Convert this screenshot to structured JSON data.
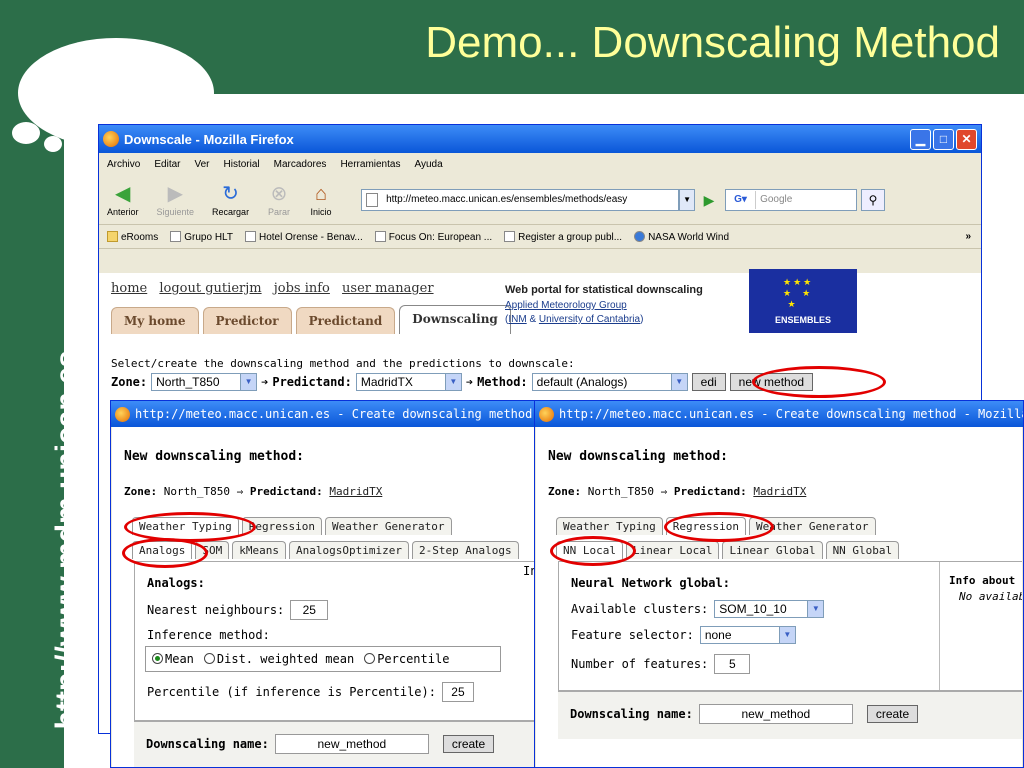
{
  "slide": {
    "title": "Demo... Downscaling Method",
    "vertical_url": "http://www.mdm.unican.es",
    "colors": {
      "green": "#2c6e49",
      "title": "#ffff99",
      "ring": "#e20000"
    }
  },
  "firefox": {
    "title": "Downscale - Mozilla Firefox",
    "menu": [
      "Archivo",
      "Editar",
      "Ver",
      "Historial",
      "Marcadores",
      "Herramientas",
      "Ayuda"
    ],
    "toolbar": {
      "back": "Anterior",
      "forward": "Siguiente",
      "reload": "Recargar",
      "stop": "Parar",
      "home": "Inicio",
      "url": "http://meteo.macc.unican.es/ensembles/methods/easy",
      "search_placeholder": "Google"
    },
    "bookmarks": [
      "eRooms",
      "Grupo HLT",
      "Hotel Orense - Benav...",
      "Focus On: European ...",
      "Register a group publ...",
      "NASA World Wind"
    ],
    "bookmarks_more": "»"
  },
  "page": {
    "links": [
      "home",
      "logout gutierjm",
      "jobs info",
      "user manager"
    ],
    "tabs": [
      "My home",
      "Predictor",
      "Predictand",
      "Downscaling"
    ],
    "portal": {
      "title": "Web portal for statistical downscaling",
      "group": "Applied Meteorology Group",
      "inm": "INM",
      "amp": "&",
      "uc": "University of Cantabria",
      "paren_open": "(",
      "paren_close": ")"
    },
    "logo_text": "ENSEMBLES",
    "select_text": "Select/create the downscaling method and the predictions to downscale:",
    "zone_label": "Zone:",
    "zone_value": "North_T850",
    "predictand_label": "Predictand:",
    "predictand_value": "MadridTX",
    "method_label": "Method:",
    "method_value": "default (Analogs)",
    "edit_button": "edi",
    "new_method_button": "new method"
  },
  "popup1": {
    "title": "http://meteo.macc.unican.es - Create downscaling method -",
    "heading": "New downscaling method:",
    "zone_label": "Zone:",
    "zone_value": "North_T850",
    "arrow": "⇒",
    "predictand_label": "Predictand:",
    "predictand_value": "MadridTX",
    "tabs_row1": [
      "Weather Typing",
      "Regression",
      "Weather Generator"
    ],
    "tabs_row2": [
      "Analogs",
      "SOM",
      "kMeans",
      "AnalogsOptimizer",
      "2-Step Analogs"
    ],
    "panel_title": "Analogs:",
    "side_char": "In",
    "nn_label": "Nearest neighbours:",
    "nn_value": "25",
    "inference_label": "Inference method:",
    "options": [
      "Mean",
      "Dist. weighted mean",
      "Percentile"
    ],
    "percentile_label": "Percentile (if inference is Percentile):",
    "percentile_value": "25",
    "name_label": "Downscaling name:",
    "name_value": "new_method",
    "create_button": "create"
  },
  "popup2": {
    "title": "http://meteo.macc.unican.es - Create downscaling method - Mozilla Fi",
    "heading": "New downscaling method:",
    "zone_label": "Zone:",
    "zone_value": "North_T850",
    "arrow": "⇒",
    "predictand_label": "Predictand:",
    "predictand_value": "MadridTX",
    "tabs_row1": [
      "Weather Typing",
      "Regression",
      "Weather Generator"
    ],
    "tabs_row2": [
      "NN Local",
      "Linear Local",
      "Linear Global",
      "NN Global"
    ],
    "panel_title": "Neural Network global:",
    "clusters_label": "Available clusters:",
    "clusters_value": "SOM_10_10",
    "feature_label": "Feature selector:",
    "feature_value": "none",
    "nfeat_label": "Number of features:",
    "nfeat_value": "5",
    "info_title": "Info about t",
    "info_text": "No availab",
    "name_label": "Downscaling name:",
    "name_value": "new_method",
    "create_button": "create"
  }
}
